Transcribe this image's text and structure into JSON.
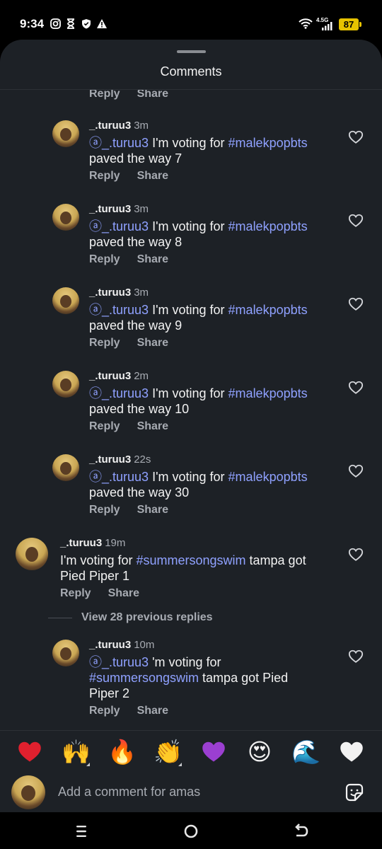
{
  "status_bar": {
    "time": "9:34",
    "network": "4.5G",
    "battery": "87"
  },
  "sheet": {
    "title": "Comments"
  },
  "actions": {
    "reply": "Reply",
    "share": "Share"
  },
  "comments": [
    {
      "username": "_.turuu3",
      "ago": "3m",
      "mention": "_.turuu3",
      "prefix": " I'm voting for ",
      "hashtag": "#malekpopbts",
      "suffix": "paved the way 7"
    },
    {
      "username": "_.turuu3",
      "ago": "3m",
      "mention": "_.turuu3",
      "prefix": " I'm voting for ",
      "hashtag": "#malekpopbts",
      "suffix": "paved the way 8"
    },
    {
      "username": "_.turuu3",
      "ago": "3m",
      "mention": "_.turuu3",
      "prefix": " I'm voting for ",
      "hashtag": "#malekpopbts",
      "suffix": "paved the way 9"
    },
    {
      "username": "_.turuu3",
      "ago": "2m",
      "mention": "_.turuu3",
      "prefix": " I'm voting for ",
      "hashtag": "#malekpopbts",
      "suffix": "paved the way 10"
    },
    {
      "username": "_.turuu3",
      "ago": "22s",
      "mention": "_.turuu3",
      "prefix": " I'm voting for ",
      "hashtag": "#malekpopbts",
      "suffix": "paved the way 30"
    },
    {
      "username": "_.turuu3",
      "ago": "19m",
      "prefix": "I'm voting for ",
      "hashtag": "#summersongswim",
      "rest": " tampa got",
      "line2": "Pied Piper 1"
    },
    {
      "username": "_.turuu3",
      "ago": "10m",
      "mention": "_.turuu3",
      "prefix": " 'm voting for",
      "hashtag": "#summersongswim",
      "rest": " tampa got Pied",
      "line3": "Piper 2"
    }
  ],
  "view_replies": "View 28 previous replies",
  "emoji_reactions": [
    {
      "name": "red-heart",
      "char": "❤",
      "color": "#e0202e"
    },
    {
      "name": "raising-hands",
      "char": "🙌",
      "color": "#f4b93a"
    },
    {
      "name": "fire",
      "char": "🔥",
      "color": "#f57c1f"
    },
    {
      "name": "clapping-hands",
      "char": "👏",
      "color": "#f4b93a"
    },
    {
      "name": "purple-heart",
      "char": "💜",
      "color": "#9b3fd1"
    },
    {
      "name": "heart-eyes",
      "char": "😍",
      "color": "#f4c542"
    },
    {
      "name": "water-wave",
      "char": "🌊",
      "color": "#2a7fd1"
    },
    {
      "name": "white-heart",
      "char": "🤍",
      "color": "#f2f2f2"
    }
  ],
  "composer": {
    "placeholder": "Add a comment for amas"
  },
  "colors": {
    "sheet_bg": "#1d2126",
    "accent_link": "#8fa1ff",
    "muted_text": "#a7abb2",
    "battery": "#e6c200"
  }
}
